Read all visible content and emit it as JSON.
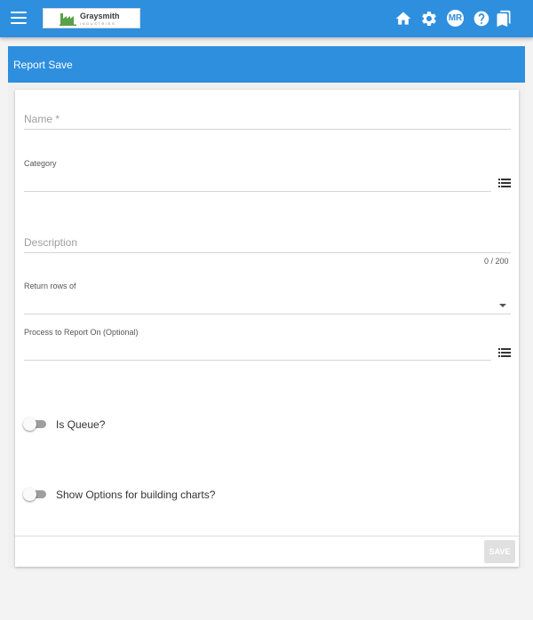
{
  "app": {
    "logo": {
      "name": "Graysmith",
      "sub": "INDUSTRIES"
    },
    "toolbar": {
      "avatar_initials": "MR",
      "icons": [
        "menu-icon",
        "home-icon",
        "gear-icon",
        "help-icon",
        "bookmark-icon"
      ]
    }
  },
  "panel": {
    "title": "Report Save"
  },
  "form": {
    "name": {
      "placeholder": "Name *",
      "value": ""
    },
    "category": {
      "label": "Category",
      "value": ""
    },
    "description": {
      "placeholder": "Description",
      "value": "",
      "counter": "0 / 200"
    },
    "return_rows": {
      "label": "Return rows of",
      "value": ""
    },
    "process": {
      "label": "Process to Report On (Optional)",
      "value": ""
    },
    "is_queue": {
      "label": "Is Queue?",
      "checked": false
    },
    "show_chart_options": {
      "label": "Show Options for building charts?",
      "checked": false
    },
    "save_label": "SAVE"
  },
  "colors": {
    "primary": "#2e8fde",
    "background": "#f3f3f3",
    "card": "#ffffff"
  }
}
